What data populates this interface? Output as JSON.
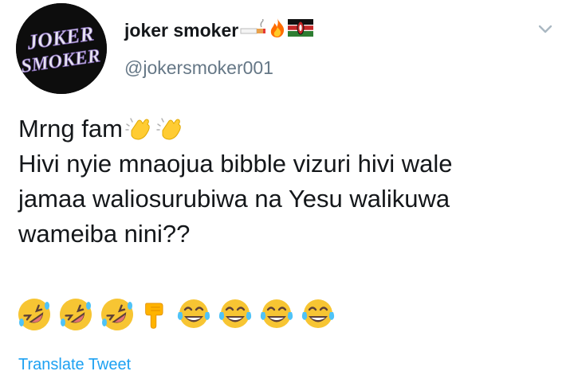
{
  "header": {
    "display_name": "joker smoker",
    "handle": "@jokersmoker001",
    "avatar_text_line1": "JOKER",
    "avatar_text_line2": "SMOKER",
    "name_emojis": [
      "cigarette-icon",
      "fire-icon",
      "kenya-flag-icon"
    ],
    "menu_icon": "chevron-down-icon"
  },
  "tweet": {
    "line1": "Mrng fam",
    "line1_emojis": [
      "clapping-hands-icon",
      "clapping-hands-icon"
    ],
    "line2": "Hivi nyie mnaojua bibble vizuri hivi wale",
    "line3": "jamaa waliosurubiwa na Yesu walikuwa",
    "line4": "wameiba nini??",
    "emoji_row": [
      "rolling-on-floor-laughing-icon",
      "rolling-on-floor-laughing-icon",
      "rolling-on-floor-laughing-icon",
      "pointing-down-icon",
      "tears-of-joy-icon",
      "tears-of-joy-icon",
      "tears-of-joy-icon",
      "tears-of-joy-icon"
    ]
  },
  "footer": {
    "translate_label": "Translate Tweet"
  },
  "colors": {
    "text": "#14171a",
    "muted": "#657786",
    "link": "#1da1f2",
    "emoji_yellow": "#f7c533"
  }
}
